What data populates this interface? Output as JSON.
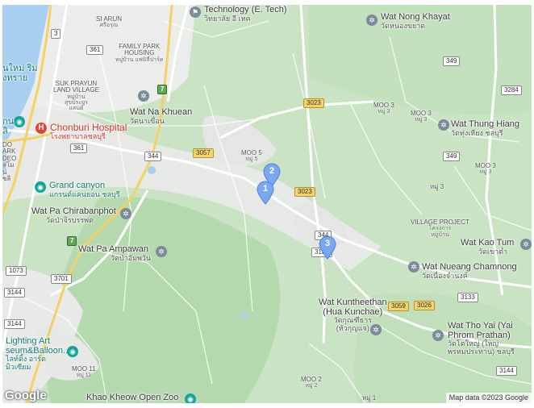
{
  "places": {
    "si_arun": {
      "name": "SI ARUN",
      "thai": "ศรีอรุณ"
    },
    "family_park": {
      "name1": "FAMILY PARK",
      "name2": "HOUSING",
      "thai": "หมู่บ้าน แฟมิลี่ปาร์ค"
    },
    "suk_prayun": {
      "name1": "SUK PRAYUN",
      "name2": "LAND VILLAGE",
      "thai1": "หมู่บ้าน",
      "thai2": "สุขประยูร",
      "thai3": "แลนด์"
    },
    "technology": {
      "name": "Technology (E. Tech)",
      "thai": "วิทยาลัย อี เทค"
    },
    "wat_nong_khayat": {
      "name": "Wat Nong Khayat",
      "thai": "วัดหนองขยาด"
    },
    "wat_na_khuean": {
      "name": "Wat Na Khuean",
      "thai": "วัดนาเขื่อน"
    },
    "chonburi_hospital": {
      "name": "Chonburi Hospital",
      "thai": "โรงพยาบาลชลบุรี"
    },
    "moo5": {
      "name": "MOO 5",
      "thai": "หมู่ 5"
    },
    "moo3a": {
      "name": "MOO 3",
      "thai": "หมู่ 3"
    },
    "moo3b": {
      "name": "MOO 3",
      "thai": "หมู่ 3"
    },
    "moo3c": {
      "name": "MOO 3",
      "thai": "หมู่ 3"
    },
    "moo3d": {
      "name": "หมู่ 3"
    },
    "wat_thung_hiang": {
      "name": "Wat Thung Hiang",
      "thai": "วัดทุ่งเหียง ชลบุรี"
    },
    "grand_canyon": {
      "name": "Grand canyon",
      "thai": "แกรนด์แคนยอน ชลบุรี"
    },
    "wat_pa_chirabanphot": {
      "name": "Wat Pa Chirabanphot",
      "thai": "วัดป่าจิรบรรพต"
    },
    "village_project": {
      "name": "VILLAGE PROJECT",
      "thai1": "โครงการ",
      "thai2": "หมู่บ้าน"
    },
    "wat_kao_tum": {
      "name": "Wat Kao Tum",
      "thai": "วัดเขาต่ำ"
    },
    "wat_pa_ampawan": {
      "name": "Wat Pa Ampawan",
      "thai": "วัดป่าอัมพวัน"
    },
    "wat_nueang_chamnong": {
      "name": "Wat Nueang Chamnong",
      "thai": "วัดเนื่องจำนงค์"
    },
    "wat_kuntheethan": {
      "name1": "Wat Kuntheethan",
      "name2": "(Hua Kunchae)",
      "thai1": "วัดกุณฑีธาร",
      "thai2": "(หัวกุญแจ)"
    },
    "wat_tho_yai": {
      "name1": "Wat Tho Yai (Yai",
      "name2": "Phrom Prathan)",
      "thai1": "วัดโตใหญ่ (ใหญ่",
      "thai2": "พรหมประทาน) ชลบุรี"
    },
    "lighting_art": {
      "name1": "Lighting Art",
      "name2": "seum&Balloon...",
      "thai1": "ไลท์ติ้ง อาร์ต",
      "thai2": "มิวเซียม"
    },
    "moo11": {
      "name": "MOO 11",
      "thai": "หมู่ 11"
    },
    "moo2": {
      "name": "MOO 2",
      "thai": "หมู่ 2"
    },
    "moo1": {
      "name": "หมู่ 1"
    },
    "khao_kheow": {
      "name": "Khao Kheow Open Zoo"
    },
    "left_cut1": {
      "name1": "นใหม่ ริม",
      "name2": "งทราย"
    },
    "left_cut2": {
      "name1": "กน",
      "name2": "ลิ"
    },
    "left_cut3": {
      "name1": "DO",
      "name2": "ARK",
      "name3": "DEO",
      "name4": "ลโม",
      "name5": "น่",
      "name6": "ชลิ"
    }
  },
  "roads": [
    "3",
    "361",
    "361",
    "344",
    "3057",
    "3023",
    "3023",
    "349",
    "349",
    "3284",
    "344",
    "3138",
    "1073",
    "3701",
    "3144",
    "3144",
    "3059",
    "3026",
    "3133",
    "3144"
  ],
  "highway_shields": [
    "7",
    "7"
  ],
  "markers": [
    "1",
    "2",
    "3"
  ],
  "branding": {
    "logo": "Google",
    "attribution": "Map data ©2023 Google"
  },
  "colors": {
    "water": "#a8cff0",
    "forest": "#b7dcb2",
    "urban": "#e9ece9",
    "road": "#ffffff",
    "highway": "#f6cf65",
    "marker": "#7aa7f2",
    "marker_dark": "#4f7fd6"
  }
}
